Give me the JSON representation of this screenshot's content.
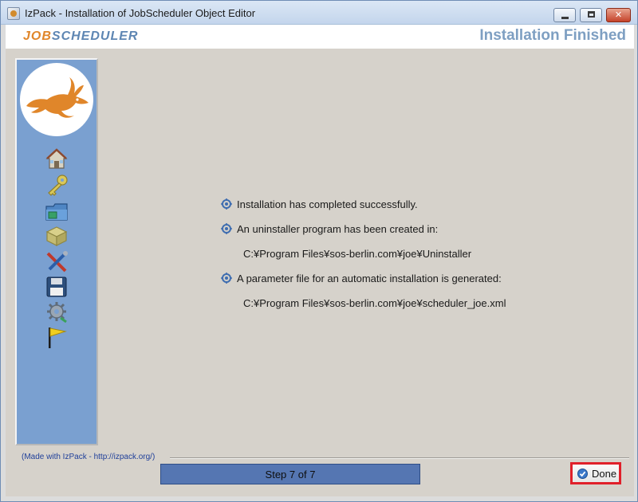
{
  "window": {
    "title": "IzPack - Installation of JobScheduler Object Editor",
    "controls": {
      "minimize": "—",
      "maximize": "□",
      "close": "✕"
    }
  },
  "header": {
    "logo_job": "JOB",
    "logo_scheduler": "SCHEDULER",
    "title": "Installation Finished"
  },
  "sidebar": {
    "steps": [
      {
        "icon": "home-icon"
      },
      {
        "icon": "key-icon"
      },
      {
        "icon": "folder-icon"
      },
      {
        "icon": "package-icon"
      },
      {
        "icon": "tools-icon"
      },
      {
        "icon": "floppy-disk-icon"
      },
      {
        "icon": "gear-icon"
      },
      {
        "icon": "flag-icon"
      }
    ]
  },
  "messages": {
    "line1": "Installation has completed successfully.",
    "line2": "An uninstaller program has been created in:",
    "path1": "C:¥Program Files¥sos-berlin.com¥joe¥Uninstaller",
    "line3": "A parameter file for an automatic installation is generated:",
    "path2": "C:¥Program Files¥sos-berlin.com¥joe¥scheduler_joe.xml"
  },
  "footer": {
    "made_with": "(Made with IzPack - http://izpack.org/)",
    "progress_label": "Step 7 of 7",
    "progress_fraction": 1.0,
    "done_label": "Done"
  },
  "colors": {
    "accent": "#5576b2",
    "sidebar": "#7aa0d0",
    "logo_orange": "#e0862a",
    "logo_blue": "#5e86b3",
    "highlight": "#e0202a"
  }
}
